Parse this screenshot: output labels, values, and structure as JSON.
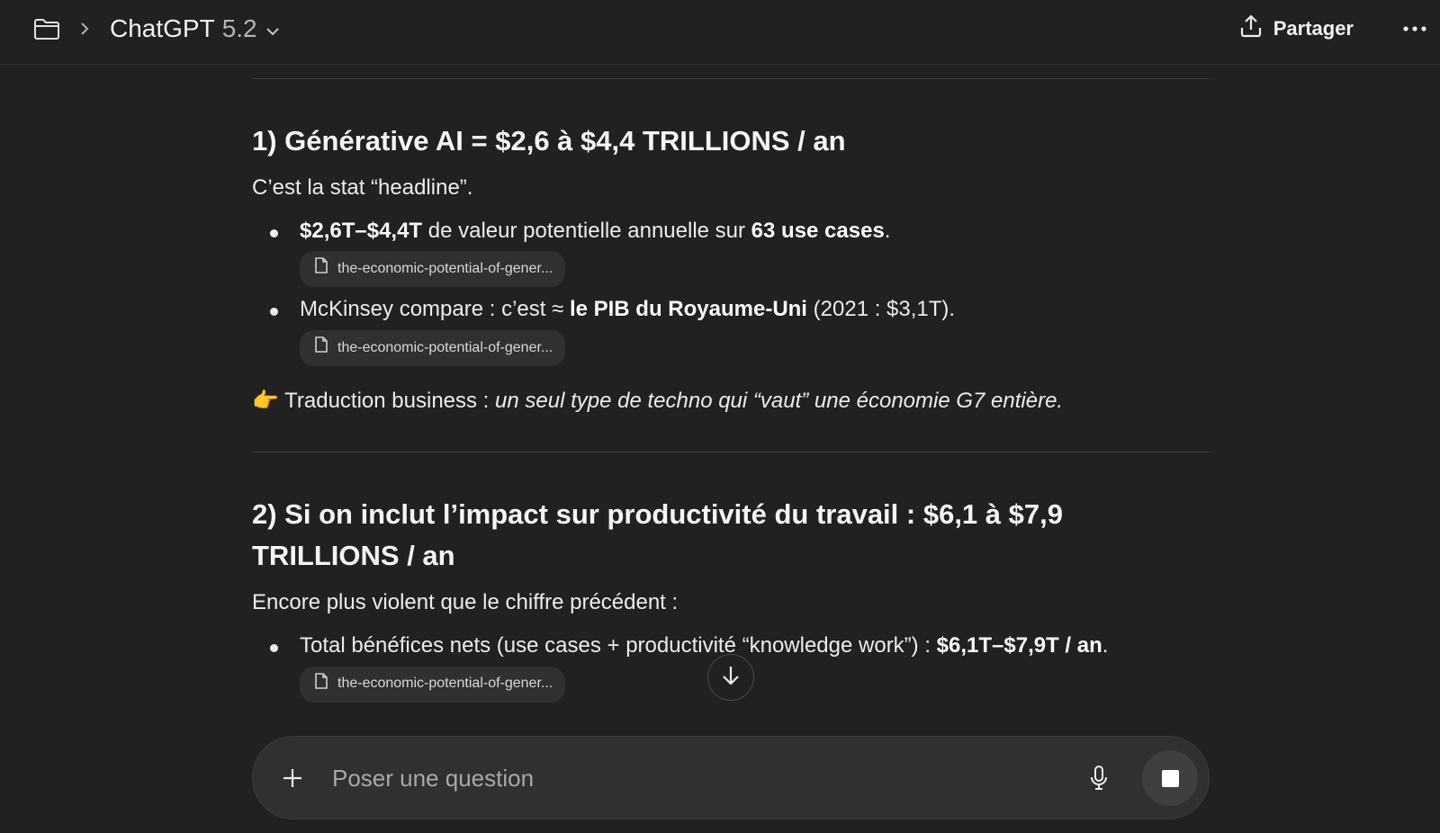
{
  "header": {
    "model_name": "ChatGPT",
    "model_version": "5.2",
    "share_label": "Partager"
  },
  "sections": [
    {
      "title": "1) Générative AI = $2,6 à $4,4 TRILLIONS / an",
      "intro": "C’est la stat “headline”.",
      "bullet1": {
        "strong_a": "$2,6T–$4,4T",
        "text_a": " de valeur potentielle annuelle sur ",
        "strong_b": "63 use cases",
        "text_b": "."
      },
      "bullet2": {
        "text_a": "McKinsey compare : c’est ≈ ",
        "strong_a": "le PIB du Royaume-Uni",
        "text_b": " (2021 : $3,1T)."
      },
      "citation": "the-economic-potential-of-gener...",
      "takeaway": {
        "emoji": "👉",
        "label": "Traduction business : ",
        "italic": "un seul type de techno qui “vaut” une économie G7 entière."
      }
    },
    {
      "title": "2) Si on inclut l’impact sur productivité du travail : $6,1 à $7,9 TRILLIONS / an",
      "intro": "Encore plus violent que le chiffre précédent :",
      "bullet1": {
        "text_a": "Total bénéfices nets (use cases + productivité “knowledge work”) : ",
        "strong_a": "$6,1T–$7,9T / an",
        "text_b": "."
      },
      "citation": "the-economic-potential-of-gener..."
    }
  ],
  "composer": {
    "placeholder": "Poser une question"
  },
  "icons": {
    "folder": "folder-icon",
    "chevron_right": "chevron-right-icon",
    "chevron_down": "chevron-down-icon",
    "share": "share-upload-icon",
    "more": "more-dots-icon",
    "file": "file-icon",
    "arrow_down": "arrow-down-icon",
    "plus": "plus-icon",
    "mic": "microphone-icon",
    "stop": "stop-icon"
  }
}
